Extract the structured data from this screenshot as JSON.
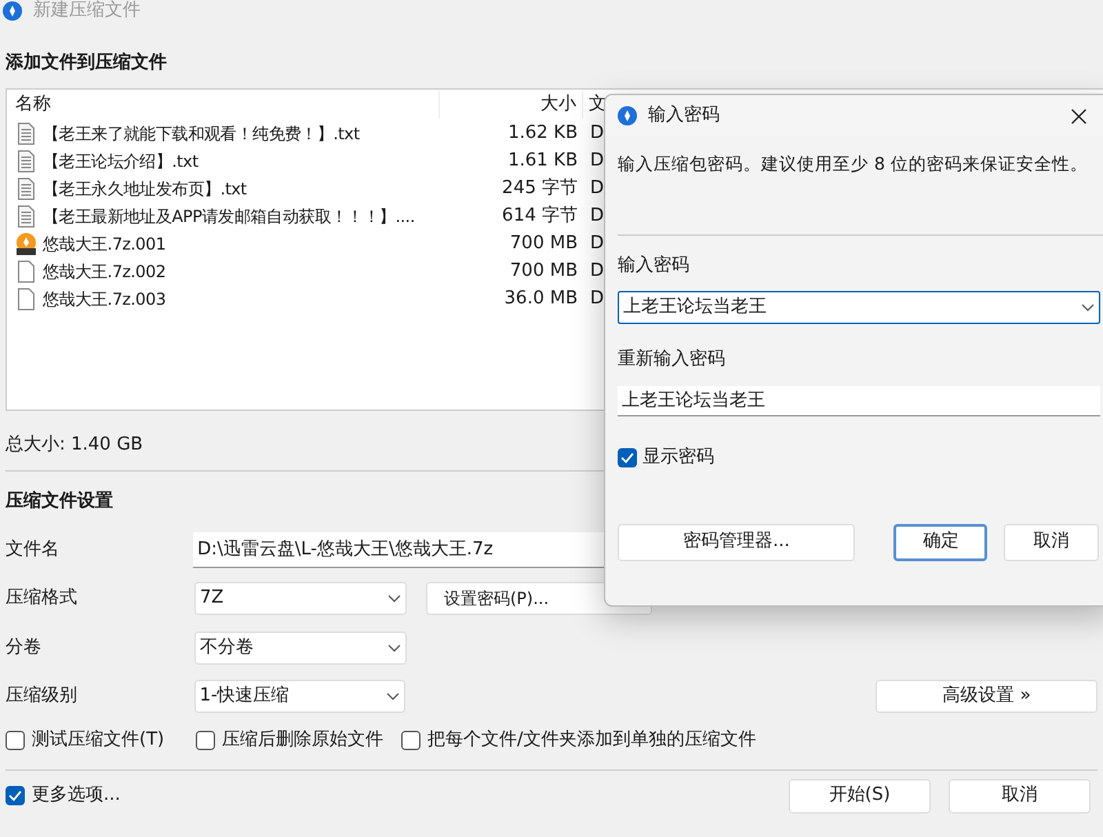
{
  "window": {
    "title": "新建压缩文件"
  },
  "heading": "添加文件到压缩文件",
  "file_list": {
    "columns": [
      "名称",
      "大小",
      "文"
    ],
    "rows": [
      {
        "kind": "text",
        "name": "【老王来了就能下载和观看！纯免费！】.txt",
        "size": "1.62 KB",
        "column_3": "D"
      },
      {
        "kind": "text",
        "name": "【老王论坛介绍】.txt",
        "size": "1.61 KB",
        "column_3": "D"
      },
      {
        "kind": "text",
        "name": "【老王永久地址发布页】.txt",
        "size": "245 字节",
        "column_3": "D"
      },
      {
        "kind": "text",
        "name": "【老王最新地址及APP请发邮箱自动获取！！！】....",
        "size": "614 字节",
        "column_3": "D"
      },
      {
        "kind": "archive",
        "name": "悠哉大王.7z.001",
        "size": "700 MB",
        "column_3": "D"
      },
      {
        "kind": "blank",
        "name": "悠哉大王.7z.002",
        "size": "700 MB",
        "column_3": "D"
      },
      {
        "kind": "blank",
        "name": "悠哉大王.7z.003",
        "size": "36.0 MB",
        "column_3": "D"
      }
    ]
  },
  "total_size": "总大小: 1.40 GB",
  "settings": {
    "heading": "压缩文件设置",
    "filename": {
      "label": "文件名",
      "value": "D:\\迅雷云盘\\L-悠哉大王\\悠哉大王.7z"
    },
    "format": {
      "label": "压缩格式",
      "value": "7Z"
    },
    "set_password_button": "设置密码(P)...",
    "volume": {
      "label": "分卷",
      "value": "不分卷"
    },
    "level": {
      "label": "压缩级别",
      "value": "1-快速压缩"
    },
    "advanced_button": "高级设置 »",
    "options": [
      {
        "label": "测试压缩文件(T)",
        "checked": false
      },
      {
        "label": "压缩后删除原始文件",
        "checked": false
      },
      {
        "label": "把每个文件/文件夹添加到单独的压缩文件",
        "checked": false
      }
    ]
  },
  "more_options": {
    "label": "更多选项...",
    "checked": true
  },
  "buttons": [
    {
      "label": "开始(S)"
    },
    {
      "label": "取消"
    }
  ],
  "dialog": {
    "title": "输入密码",
    "description": "输入压缩包密码。建议使用至少 8 位的密码来保证安全性。",
    "password": {
      "label": "输入密码",
      "value": "上老王论坛当老王"
    },
    "confirm": {
      "label": "重新输入密码",
      "value": "上老王论坛当老王"
    },
    "show_password": {
      "label": "显示密码",
      "checked": true
    },
    "buttons": [
      {
        "label": "密码管理器...",
        "default": false
      },
      {
        "label": "确定",
        "default": true
      },
      {
        "label": "取消",
        "default": false
      }
    ]
  }
}
